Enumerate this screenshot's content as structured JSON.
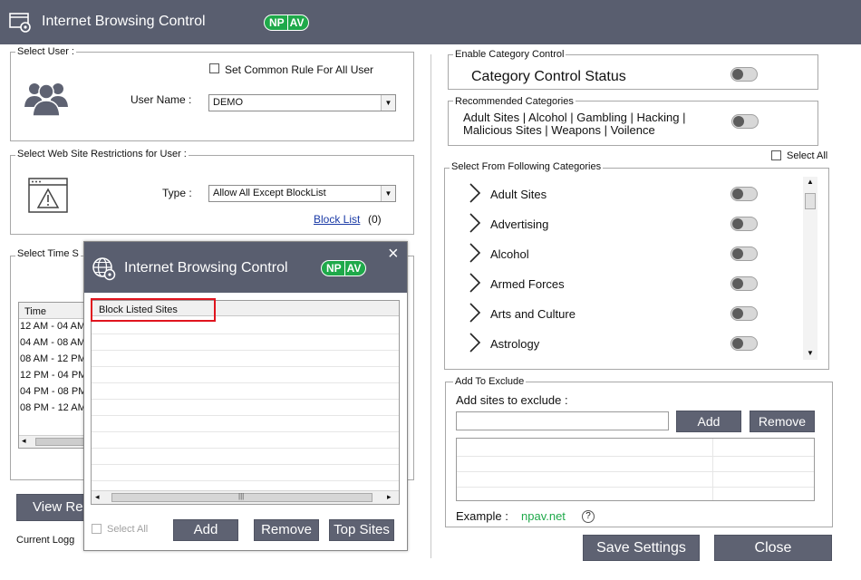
{
  "app": {
    "title": "Internet Browsing Control",
    "logo_np": "NP",
    "logo_av": "AV"
  },
  "select_user": {
    "legend": "Select User :",
    "common_rule_label": "Set Common Rule For All User",
    "user_name_label": "User Name :",
    "user_name_value": "DEMO"
  },
  "restrictions": {
    "legend": "Select Web Site Restrictions for User :",
    "type_label": "Type :",
    "type_value": "Allow All Except BlockList",
    "block_list_link": "Block List",
    "block_list_count": "(0)"
  },
  "time": {
    "legend": "Select Time S",
    "column": "Time",
    "rows": [
      "12 AM - 04 AM",
      "04 AM - 08 AM",
      "08 AM - 12 PM",
      "12 PM - 04 PM",
      "04 PM - 08 PM",
      "08 PM - 12 AM"
    ]
  },
  "view_report_label": "View Re",
  "current_logged_label": "Current Logg",
  "category_control": {
    "legend": "Enable Category Control",
    "status_label": "Category Control Status"
  },
  "recommended": {
    "legend": "Recommended Categories",
    "line1": "Adult Sites | Alcohol | Gambling | Hacking |",
    "line2": "Malicious Sites | Weapons | Voilence"
  },
  "select_all_label": "Select All",
  "categories": {
    "legend": "Select  From Following Categories",
    "items": [
      "Adult Sites",
      "Advertising",
      "Alcohol",
      "Armed Forces",
      "Arts and Culture",
      "Astrology"
    ]
  },
  "exclude": {
    "legend": "Add To Exclude",
    "prompt": "Add sites to exclude :",
    "input_value": "",
    "add_label": "Add",
    "remove_label": "Remove",
    "example_label": "Example :",
    "example_value": "npav.net",
    "help_glyph": "?"
  },
  "footer": {
    "save_label": "Save Settings",
    "close_label": "Close"
  },
  "modal": {
    "title": "Internet Browsing Control",
    "close_glyph": "×",
    "column": "Block Listed Sites",
    "select_all_label": "Select All",
    "add_label": "Add",
    "remove_label": "Remove",
    "top_sites_label": "Top Sites",
    "highlight_color": "#e0141e"
  }
}
